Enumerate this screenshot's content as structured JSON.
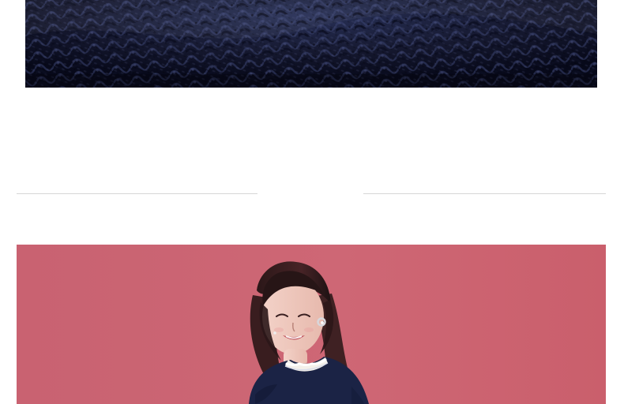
{
  "product_images": {
    "fabric_detail": {
      "color": "#15182f"
    },
    "model_shot": {
      "background_color": "#c95d6b",
      "garment_color": "#1b2345",
      "collar_trim_color": "#f4f0ea"
    }
  },
  "separator": {
    "line_color": "#d6d6d6"
  }
}
